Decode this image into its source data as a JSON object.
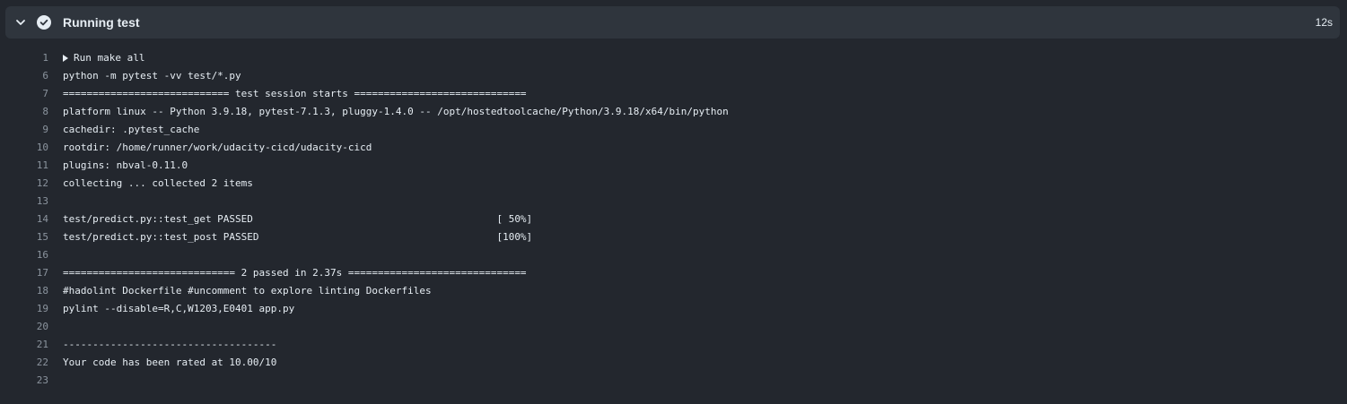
{
  "step": {
    "title": "Running test",
    "duration": "12s",
    "status": "success",
    "expanded": true
  },
  "log": [
    {
      "num": "1",
      "text": "Run make all",
      "group": true
    },
    {
      "num": "6",
      "text": "python -m pytest -vv test/*.py"
    },
    {
      "num": "7",
      "text": "============================ test session starts ============================="
    },
    {
      "num": "8",
      "text": "platform linux -- Python 3.9.18, pytest-7.1.3, pluggy-1.4.0 -- /opt/hostedtoolcache/Python/3.9.18/x64/bin/python"
    },
    {
      "num": "9",
      "text": "cachedir: .pytest_cache"
    },
    {
      "num": "10",
      "text": "rootdir: /home/runner/work/udacity-cicd/udacity-cicd"
    },
    {
      "num": "11",
      "text": "plugins: nbval-0.11.0"
    },
    {
      "num": "12",
      "text": "collecting ... collected 2 items"
    },
    {
      "num": "13",
      "text": ""
    },
    {
      "num": "14",
      "text": "test/predict.py::test_get PASSED                                         [ 50%]"
    },
    {
      "num": "15",
      "text": "test/predict.py::test_post PASSED                                        [100%]"
    },
    {
      "num": "16",
      "text": ""
    },
    {
      "num": "17",
      "text": "============================= 2 passed in 2.37s =============================="
    },
    {
      "num": "18",
      "text": "#hadolint Dockerfile #uncomment to explore linting Dockerfiles"
    },
    {
      "num": "19",
      "text": "pylint --disable=R,C,W1203,E0401 app.py"
    },
    {
      "num": "20",
      "text": ""
    },
    {
      "num": "21",
      "text": "------------------------------------"
    },
    {
      "num": "22",
      "text": "Your code has been rated at 10.00/10"
    },
    {
      "num": "23",
      "text": ""
    }
  ],
  "colors": {
    "background": "#23272e",
    "header": "#2f353d",
    "text": "#e6edf3",
    "line_number": "#8b949e"
  },
  "icons": {
    "chevron": "chevron-down-icon",
    "status": "check-circle-icon",
    "group": "triangle-right-icon"
  }
}
